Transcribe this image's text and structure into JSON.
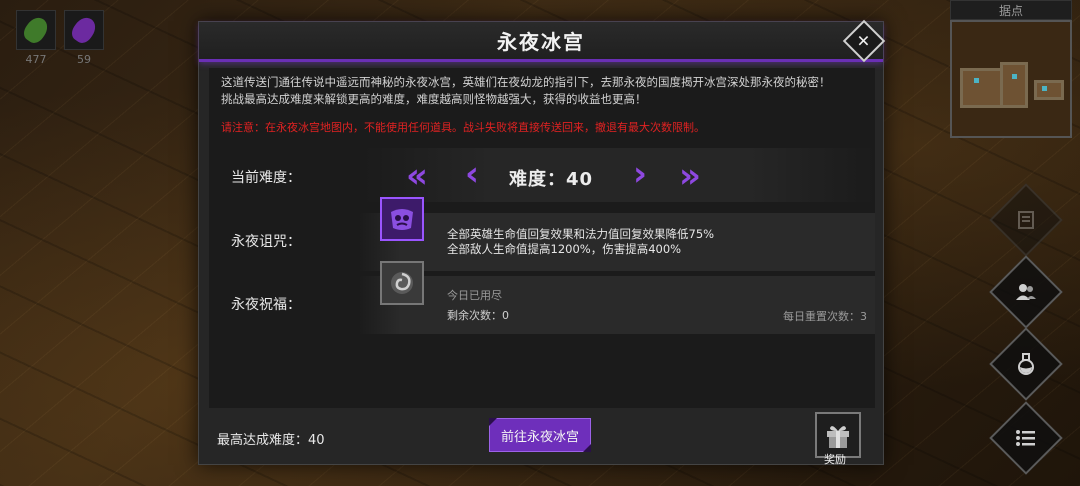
{
  "resources": [
    {
      "icon": "green-leaf-gem",
      "count": "477",
      "color": "#3f7a2a"
    },
    {
      "icon": "purple-feather-gem",
      "count": "59",
      "color": "#6c2aa0"
    }
  ],
  "minimap": {
    "title": "据点"
  },
  "dialog": {
    "title": "永夜冰宫",
    "close_label": "✕",
    "description": [
      "这道传送门通往传说中遥远而神秘的永夜冰宫，英雄们在夜幼龙的指引下，去那永夜的国度揭开冰宫深处那永夜的秘密！",
      "挑战最高达成难度来解锁更高的难度，难度越高则怪物越强大，获得的收益也更高！"
    ],
    "warning": "请注意：在永夜冰宫地图内，不能使用任何道具。战斗失败将直接传送回来，撤退有最大次数限制。",
    "difficulty": {
      "label": "当前难度：",
      "value_text": "难度：40",
      "first": "«",
      "prev": "‹",
      "next": "›",
      "last": "»"
    },
    "curse": {
      "label": "永夜诅咒：",
      "line1": "全部英雄生命值回复效果和法力值回复效果降低75%",
      "line2": "全部敌人生命值提高1200%，伤害提高400%"
    },
    "blessing": {
      "label": "永夜祝福：",
      "status": "今日已用尽",
      "remaining": "剩余次数：0",
      "daily_reset": "每日重置次数：3"
    },
    "footer": {
      "highest_label": "最高达成难度：40",
      "go_button": "前往永夜冰宫",
      "reward_label": "奖励"
    }
  },
  "colors": {
    "accent": "#6e2fbb",
    "warning": "#e02222"
  }
}
